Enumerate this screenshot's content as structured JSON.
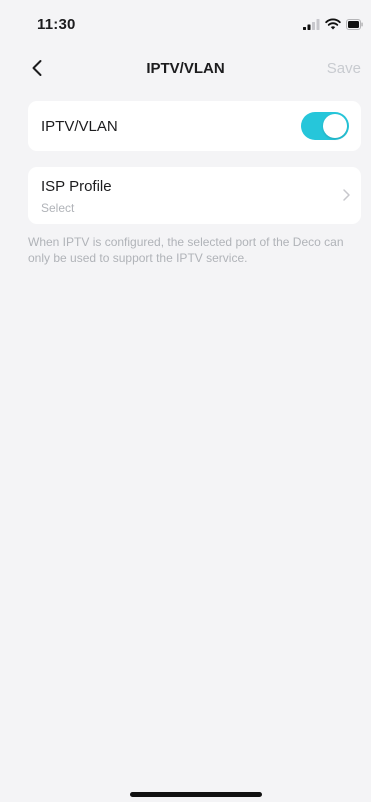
{
  "status_bar": {
    "time": "11:30",
    "icons": [
      "cellular-signal-icon",
      "wifi-icon",
      "battery-icon"
    ]
  },
  "nav": {
    "back_icon": "chevron-left-icon",
    "title": "IPTV/VLAN",
    "save_label": "Save"
  },
  "iptv_toggle": {
    "label": "IPTV/VLAN",
    "enabled": true
  },
  "isp_profile": {
    "label": "ISP Profile",
    "value": "Select",
    "icon": "chevron-right-icon"
  },
  "note": "When IPTV is configured, the selected port of the Deco can only be used to support the IPTV service.",
  "colors": {
    "accent": "#26c6da",
    "background": "#f4f4f6",
    "card": "#ffffff",
    "muted_text": "#b0b3b8",
    "disabled_text": "#c8cbd0"
  }
}
